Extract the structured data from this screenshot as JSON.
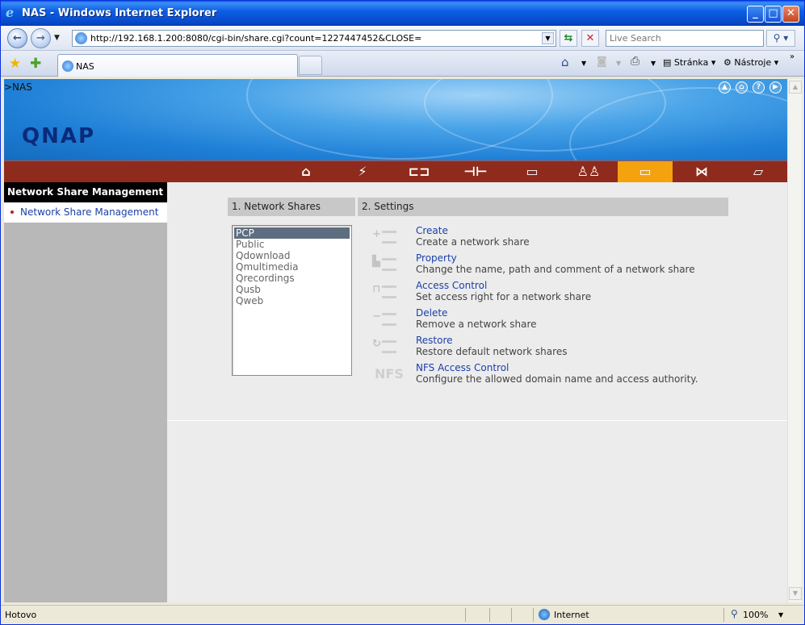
{
  "window": {
    "title": "NAS - Windows Internet Explorer",
    "app_icon": "e"
  },
  "nav": {
    "url": "http://192.168.1.200:8080/cgi-bin/share.cgi?count=1227447452&CLOSE=",
    "search_placeholder": "Live Search"
  },
  "tabs": [
    {
      "label": "NAS"
    }
  ],
  "commands": {
    "page": "Stránka",
    "tools": "Nástroje"
  },
  "page": {
    "breadcrumb": ">NAS",
    "logo": "QNAP",
    "left_menu": {
      "header": "Network Share Management",
      "items": [
        {
          "label": "Network Share Management"
        }
      ]
    },
    "sections": {
      "shares_header": "1. Network Shares",
      "settings_header": "2. Settings"
    },
    "shares": [
      "PCP",
      "Public",
      "Qdownload",
      "Qmultimedia",
      "Qrecordings",
      "Qusb",
      "Qweb"
    ],
    "selected_share": "PCP",
    "actions": [
      {
        "title": "Create",
        "desc": "Create a network share",
        "icon": "plus"
      },
      {
        "title": "Property",
        "desc": "Change the name, path and comment of a network share",
        "icon": "property"
      },
      {
        "title": "Access Control",
        "desc": "Set access right for a network share",
        "icon": "lock"
      },
      {
        "title": "Delete",
        "desc": "Remove a network share",
        "icon": "minus"
      },
      {
        "title": "Restore",
        "desc": "Restore default network shares",
        "icon": "restore"
      },
      {
        "title": "NFS Access Control",
        "desc": "Configure the allowed domain name and access authority.",
        "icon": "nfs"
      }
    ],
    "nfs_icon_text": "NFS"
  },
  "status": {
    "text": "Hotovo",
    "zone": "Internet",
    "zoom": "100%"
  },
  "colors": {
    "nav_strip": "#8e2b1c",
    "nav_active": "#f5a20f",
    "link": "#1b3fa8"
  }
}
